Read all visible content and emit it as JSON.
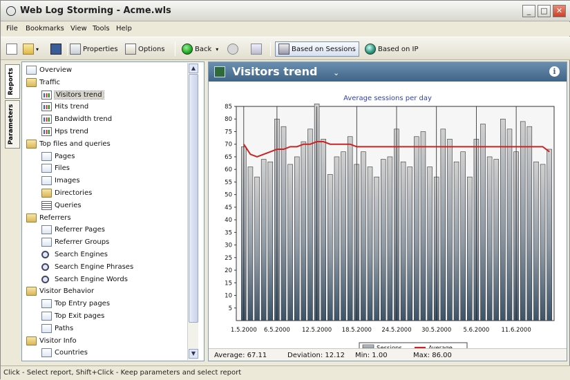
{
  "window": {
    "title": "Web Log Storming - Acme.wls",
    "minimize_glyph": "_",
    "maximize_glyph": "□",
    "close_glyph": "✕"
  },
  "menu": [
    "File",
    "Bookmarks",
    "View",
    "Tools",
    "Help"
  ],
  "toolbar": {
    "properties_label": "Properties",
    "options_label": "Options",
    "back_label": "Back",
    "sessions_label": "Based on Sessions",
    "ip_label": "Based on IP"
  },
  "side_tabs": [
    "Reports",
    "Parameters"
  ],
  "tree": [
    {
      "label": "Overview",
      "indent": 0,
      "icon": "page-icon"
    },
    {
      "label": "Traffic",
      "indent": 0,
      "icon": "folder-icon"
    },
    {
      "label": "Visitors trend",
      "indent": 1,
      "icon": "chart-icon",
      "selected": true
    },
    {
      "label": "Hits trend",
      "indent": 1,
      "icon": "chart-icon"
    },
    {
      "label": "Bandwidth trend",
      "indent": 1,
      "icon": "chart-icon"
    },
    {
      "label": "Hps trend",
      "indent": 1,
      "icon": "chart-icon"
    },
    {
      "label": "Top files and queries",
      "indent": 0,
      "icon": "folder-icon"
    },
    {
      "label": "Pages",
      "indent": 1,
      "icon": "page-icon"
    },
    {
      "label": "Files",
      "indent": 1,
      "icon": "page-icon"
    },
    {
      "label": "Images",
      "indent": 1,
      "icon": "page-icon"
    },
    {
      "label": "Directories",
      "indent": 1,
      "icon": "folder-icon"
    },
    {
      "label": "Queries",
      "indent": 1,
      "icon": "list-icon"
    },
    {
      "label": "Referrers",
      "indent": 0,
      "icon": "folder-icon"
    },
    {
      "label": "Referrer Pages",
      "indent": 1,
      "icon": "page-icon"
    },
    {
      "label": "Referrer Groups",
      "indent": 1,
      "icon": "page-icon"
    },
    {
      "label": "Search Engines",
      "indent": 1,
      "icon": "magnifier-icon"
    },
    {
      "label": "Search Engine Phrases",
      "indent": 1,
      "icon": "magnifier-icon"
    },
    {
      "label": "Search Engine Words",
      "indent": 1,
      "icon": "magnifier-icon"
    },
    {
      "label": "Visitor Behavior",
      "indent": 0,
      "icon": "folder-icon"
    },
    {
      "label": "Top Entry pages",
      "indent": 1,
      "icon": "page-icon"
    },
    {
      "label": "Top Exit pages",
      "indent": 1,
      "icon": "page-icon"
    },
    {
      "label": "Paths",
      "indent": 1,
      "icon": "page-icon"
    },
    {
      "label": "Visitor Info",
      "indent": 0,
      "icon": "folder-icon"
    },
    {
      "label": "Countries",
      "indent": 1,
      "icon": "page-icon"
    }
  ],
  "panel": {
    "title": "Visitors trend",
    "caret": "⌄",
    "info": "i"
  },
  "stats": {
    "average": "Average: 67.11",
    "deviation": "Deviation: 12.12",
    "min": "Min: 1.00",
    "max": "Max: 86.00"
  },
  "status_text": "Click - Select report, Shift+Click - Keep parameters and select report",
  "colors": {
    "header_blue": "#4a6f93",
    "bar_top": "#d0d0d0",
    "bar_bottom": "#3d5468",
    "average_line": "#cc2222",
    "chart_title": "#3340b0"
  },
  "chart_data": {
    "type": "bar",
    "title": "Average sessions per day",
    "ylim": [
      0,
      85
    ],
    "yticks": [
      85,
      80,
      75,
      70,
      65,
      60,
      55,
      50,
      45,
      40,
      35,
      30,
      25,
      20,
      15,
      10,
      5
    ],
    "xtick_labels": [
      "1.5.2000",
      "6.5.2000",
      "12.5.2000",
      "18.5.2000",
      "24.5.2000",
      "30.5.2000",
      "5.6.2000",
      "11.6.2000"
    ],
    "xtick_index": [
      0,
      5,
      11,
      17,
      23,
      29,
      35,
      41
    ],
    "series": [
      {
        "name": "Sessions",
        "values": [
          69,
          61,
          57,
          64,
          63,
          80,
          77,
          62,
          65,
          71,
          76,
          86,
          72,
          58,
          65,
          67,
          73,
          62,
          67,
          61,
          57,
          64,
          65,
          76,
          63,
          61,
          73,
          75,
          61,
          57,
          76,
          72,
          63,
          67,
          57,
          72,
          78,
          65,
          64,
          80,
          76,
          67,
          79,
          77,
          63,
          62,
          68
        ]
      },
      {
        "name": "Average",
        "values": [
          70,
          66,
          65,
          66,
          67,
          68,
          68,
          69,
          69,
          70,
          70,
          71,
          71,
          70,
          70,
          70,
          70,
          69,
          69,
          69,
          69,
          69,
          69,
          69,
          69,
          69,
          69,
          69,
          69,
          69,
          69,
          69,
          69,
          69,
          69,
          69,
          69,
          69,
          69,
          69,
          69,
          69,
          69,
          69,
          69,
          69,
          67
        ]
      }
    ],
    "legend": [
      "Sessions",
      "Average"
    ],
    "legend_position": "bottom"
  }
}
